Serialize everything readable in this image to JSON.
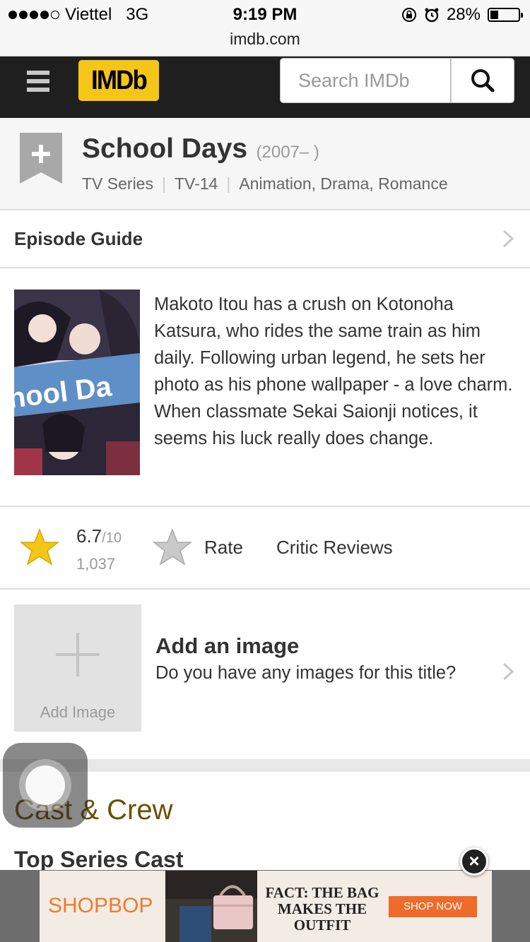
{
  "status_bar": {
    "carrier": "Viettel",
    "network": "3G",
    "time": "9:19 PM",
    "battery": "28%",
    "battery_level": 0.28,
    "url": "imdb.com"
  },
  "header": {
    "logo": "IMDb",
    "search_placeholder": "Search IMDb"
  },
  "title": {
    "name": "School Days",
    "year": "(2007– )",
    "type": "TV Series",
    "rating_cert": "TV-14",
    "genres": "Animation, Drama, Romance"
  },
  "episode_guide": {
    "label": "Episode Guide"
  },
  "plot": {
    "text": "Makoto Itou has a crush on Kotonoha Katsura, who rides the same train as him daily. Following urban legend, he sets her photo as his phone wallpaper - a love charm. When classmate Sekai Saionji notices, it seems his luck really does change."
  },
  "rating": {
    "value": "6.7",
    "max": "/10",
    "count": "1,037",
    "rate_label": "Rate",
    "critic_label": "Critic Reviews"
  },
  "add_image": {
    "box_label": "Add Image",
    "title": "Add an image",
    "subtitle": "Do you have any images for this title?"
  },
  "cast": {
    "heading": "Cast & Crew",
    "subheading": "Top Series Cast"
  },
  "ad": {
    "brand": "SHOPBOP",
    "headline": "FACT: THE BAG MAKES THE OUTFIT",
    "cta": "SHOP NOW"
  },
  "colors": {
    "imdb_yellow": "#f5c518",
    "header_bg": "#1f1f1f",
    "cast_heading": "#6b5000",
    "ad_orange": "#ef6b2a"
  }
}
